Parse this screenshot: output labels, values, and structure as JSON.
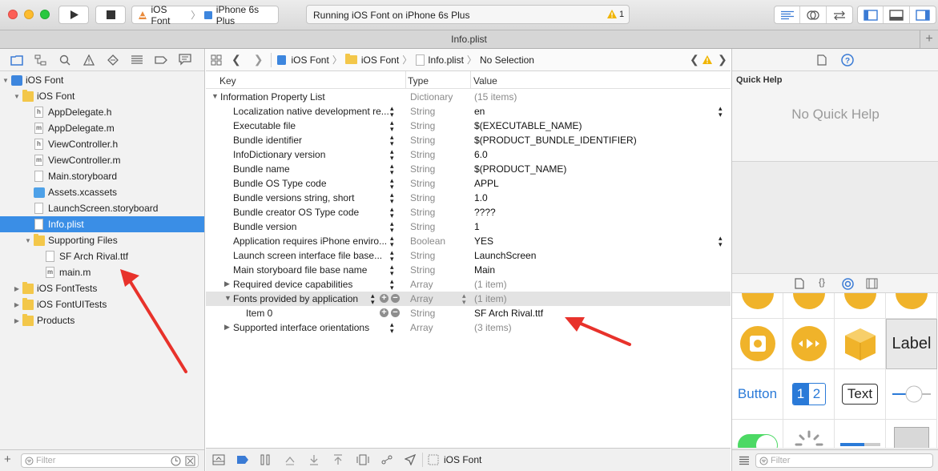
{
  "toolbar": {
    "scheme": "iOS Font",
    "device": "iPhone 6s Plus",
    "status": "Running iOS Font on iPhone 6s Plus",
    "warning_count": "1"
  },
  "tab": {
    "title": "Info.plist"
  },
  "navigator": {
    "items": [
      {
        "label": "iOS Font",
        "kind": "project",
        "disclosure": "▼"
      },
      {
        "label": "iOS Font",
        "kind": "folder",
        "disclosure": "▼"
      },
      {
        "label": "AppDelegate.h",
        "kind": "h"
      },
      {
        "label": "AppDelegate.m",
        "kind": "m"
      },
      {
        "label": "ViewController.h",
        "kind": "h"
      },
      {
        "label": "ViewController.m",
        "kind": "m"
      },
      {
        "label": "Main.storyboard",
        "kind": "storyboard"
      },
      {
        "label": "Assets.xcassets",
        "kind": "assets"
      },
      {
        "label": "LaunchScreen.storyboard",
        "kind": "storyboard"
      },
      {
        "label": "Info.plist",
        "kind": "plist",
        "selected": true
      },
      {
        "label": "Supporting Files",
        "kind": "folder",
        "disclosure": "▼"
      },
      {
        "label": "SF Arch Rival.ttf",
        "kind": "ttf"
      },
      {
        "label": "main.m",
        "kind": "m"
      },
      {
        "label": "iOS FontTests",
        "kind": "folder",
        "disclosure": "▶"
      },
      {
        "label": "iOS FontUITests",
        "kind": "folder",
        "disclosure": "▶"
      },
      {
        "label": "Products",
        "kind": "folder",
        "disclosure": "▶"
      }
    ],
    "filter_placeholder": "Filter"
  },
  "jumpbar": {
    "crumbs": [
      "iOS Font",
      "iOS Font",
      "Info.plist",
      "No Selection"
    ]
  },
  "plist": {
    "headers": {
      "key": "Key",
      "type": "Type",
      "value": "Value"
    },
    "rows": [
      {
        "key": "Information Property List",
        "type": "Dictionary",
        "value": "(15 items)",
        "level": 0,
        "disc": "▼",
        "gray": true
      },
      {
        "key": "Localization native development re...",
        "type": "String",
        "value": "en",
        "level": 1,
        "popup": true
      },
      {
        "key": "Executable file",
        "type": "String",
        "value": "$(EXECUTABLE_NAME)",
        "level": 1
      },
      {
        "key": "Bundle identifier",
        "type": "String",
        "value": "$(PRODUCT_BUNDLE_IDENTIFIER)",
        "level": 1
      },
      {
        "key": "InfoDictionary version",
        "type": "String",
        "value": "6.0",
        "level": 1
      },
      {
        "key": "Bundle name",
        "type": "String",
        "value": "$(PRODUCT_NAME)",
        "level": 1
      },
      {
        "key": "Bundle OS Type code",
        "type": "String",
        "value": "APPL",
        "level": 1
      },
      {
        "key": "Bundle versions string, short",
        "type": "String",
        "value": "1.0",
        "level": 1
      },
      {
        "key": "Bundle creator OS Type code",
        "type": "String",
        "value": "????",
        "level": 1
      },
      {
        "key": "Bundle version",
        "type": "String",
        "value": "1",
        "level": 1
      },
      {
        "key": "Application requires iPhone enviro...",
        "type": "Boolean",
        "value": "YES",
        "level": 1,
        "popup": true
      },
      {
        "key": "Launch screen interface file base...",
        "type": "String",
        "value": "LaunchScreen",
        "level": 1
      },
      {
        "key": "Main storyboard file base name",
        "type": "String",
        "value": "Main",
        "level": 1
      },
      {
        "key": "Required device capabilities",
        "type": "Array",
        "value": "(1 item)",
        "level": 1,
        "disc": "▶",
        "gray": true
      },
      {
        "key": "Fonts provided by application",
        "type": "Array",
        "value": "(1 item)",
        "level": 1,
        "disc": "▼",
        "gray": true,
        "highlight": true
      },
      {
        "key": "Item 0",
        "type": "String",
        "value": "SF Arch Rival.ttf",
        "level": 2
      },
      {
        "key": "Supported interface orientations",
        "type": "Array",
        "value": "(3 items)",
        "level": 1,
        "disc": "▶",
        "gray": true
      }
    ]
  },
  "debugbar": {
    "target": "iOS Font"
  },
  "inspector": {
    "quick_help_title": "Quick Help",
    "no_help": "No Quick Help",
    "library": {
      "button_label": "Button",
      "label_label": "Label",
      "text_label": "Text",
      "seg_1": "1",
      "seg_2": "2"
    },
    "filter_placeholder": "Filter"
  },
  "colors": {
    "selection": "#3a8ee6",
    "arrow": "#e8322b",
    "folder": "#f3c74a",
    "library_accent": "#f0b32a"
  }
}
